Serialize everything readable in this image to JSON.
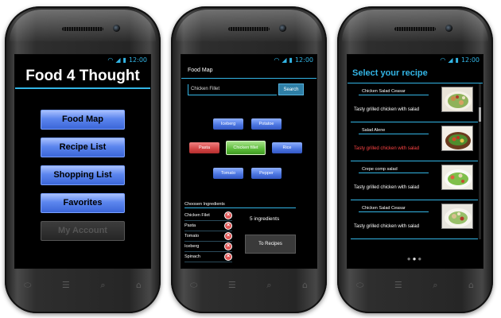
{
  "status": {
    "time": "12:00",
    "wifi_icon": "wifi-icon",
    "signal_icon": "signal-icon",
    "battery_icon": "battery-icon"
  },
  "nav_icons": [
    "back-icon",
    "home-icon",
    "search-icon",
    "recent-apps-icon"
  ],
  "colors": {
    "accent": "#33b5e5",
    "button_blue": "#5c86ee",
    "remove_red": "#e05555",
    "selected_green": "#5cbc3a"
  },
  "screen1": {
    "title": "Food 4 Thought",
    "menu": {
      "food_map": "Food Map",
      "recipe_list": "Recipe List",
      "shopping_list": "Shopping List",
      "favorites": "Favorites",
      "my_account": "My Account"
    }
  },
  "screen2": {
    "title": "Food Map",
    "search_value": "Chicken Fillet",
    "search_button": "Search",
    "chips": {
      "iceberg": "Iceberg",
      "potatoe": "Potatoe",
      "pasta": "Pasta",
      "chicken": "Chicken fillet",
      "rice": "Rice",
      "tomato": "Tomato",
      "pepper": "Pepper"
    },
    "chosen_title": "Choosen Ingredients",
    "chosen": [
      "Chicken Filet",
      "Pasta",
      "Tomato",
      "Iceberg",
      "Spinach"
    ],
    "count_label": "5 ingredients",
    "to_recipes": "To Recipes"
  },
  "screen3": {
    "title": "Select your recipe",
    "recipes": [
      {
        "name": "Chicken Salad Ceasar",
        "desc": "Tasty grilled chicken with salad"
      },
      {
        "name": "Salad Alene",
        "desc": "Tasty grilled chicken with salad"
      },
      {
        "name": "Crepe comp salad",
        "desc": "Tasty grilled chicken with salad"
      },
      {
        "name": "Chicken Salad Ceasar",
        "desc": "Tasty grilled chicken with salad"
      }
    ]
  }
}
